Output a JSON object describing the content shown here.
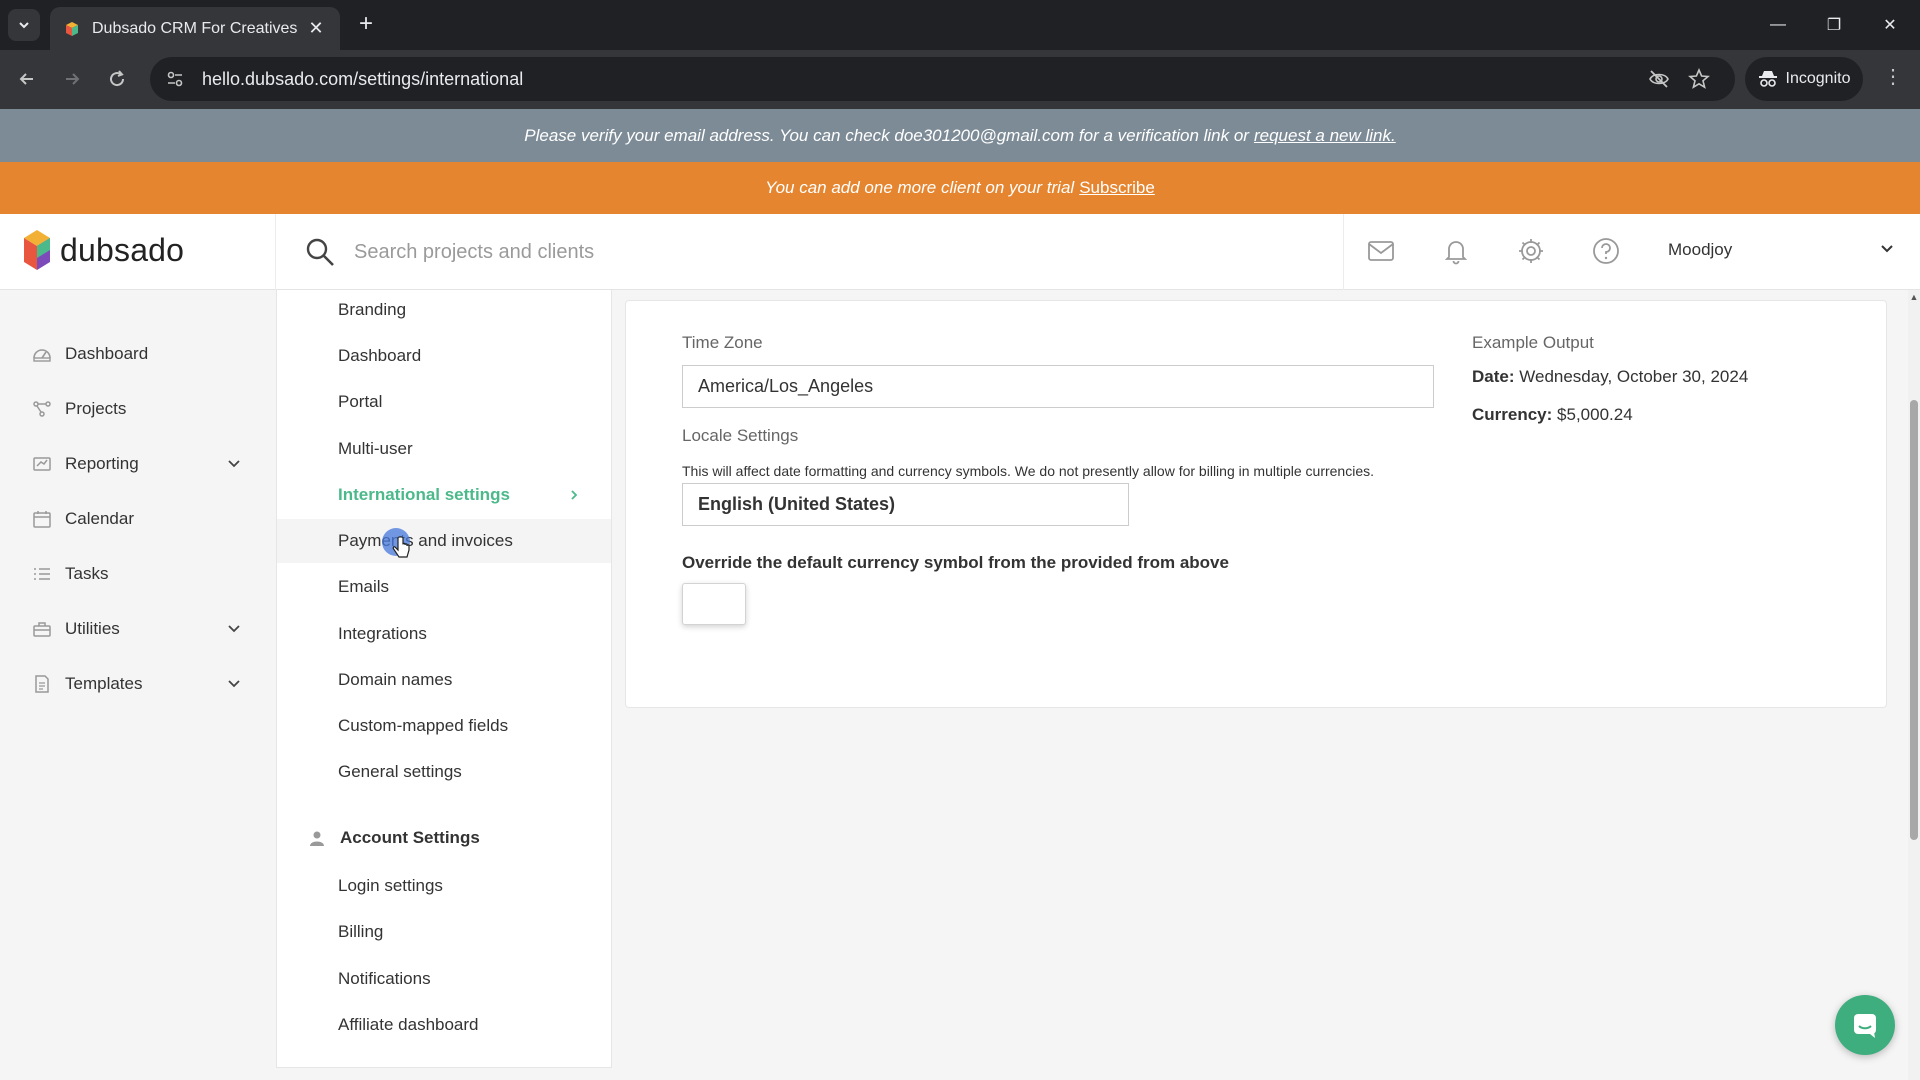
{
  "browser": {
    "tab_title": "Dubsado CRM For Creatives",
    "url": "hello.dubsado.com/settings/international",
    "incognito_label": "Incognito"
  },
  "banners": {
    "verify_text": "Please verify your email address. You can check doe301200@gmail.com for a verification link or",
    "verify_link": "request a new link.",
    "trial_text": "You can add one more client on your trial",
    "trial_link": "Subscribe"
  },
  "header": {
    "brand": "dubsado",
    "search_placeholder": "Search projects and clients",
    "user_name": "Moodjoy"
  },
  "leftnav": {
    "items": [
      {
        "label": "Dashboard",
        "icon": "dashboard-icon"
      },
      {
        "label": "Projects",
        "icon": "projects-icon"
      },
      {
        "label": "Reporting",
        "icon": "reporting-icon"
      },
      {
        "label": "Calendar",
        "icon": "calendar-icon"
      },
      {
        "label": "Tasks",
        "icon": "tasks-icon"
      },
      {
        "label": "Utilities",
        "icon": "utilities-icon"
      },
      {
        "label": "Templates",
        "icon": "templates-icon"
      }
    ]
  },
  "subnav": {
    "items": [
      "Branding",
      "Dashboard",
      "Portal",
      "Multi-user",
      "International settings",
      "Payments and invoices",
      "Emails",
      "Integrations",
      "Domain names",
      "Custom-mapped fields",
      "General settings"
    ],
    "account_heading": "Account Settings",
    "account_items": [
      "Login settings",
      "Billing",
      "Notifications",
      "Affiliate dashboard"
    ]
  },
  "international": {
    "timezone_label": "Time Zone",
    "timezone_value": "America/Los_Angeles",
    "locale_label": "Locale Settings",
    "locale_help": "This will affect date formatting and currency symbols. We do not presently allow for billing in multiple currencies.",
    "locale_value": "English (United States)",
    "override_label": "Override the default currency symbol from the provided from above",
    "example_heading": "Example Output",
    "date_label": "Date:",
    "date_value": "Wednesday, October 30, 2024",
    "currency_label": "Currency:",
    "currency_value": "$5,000.24"
  },
  "colors": {
    "accent_green": "#4bb98a",
    "trial_orange": "#e6852f",
    "verify_gray": "#7d8b97"
  }
}
